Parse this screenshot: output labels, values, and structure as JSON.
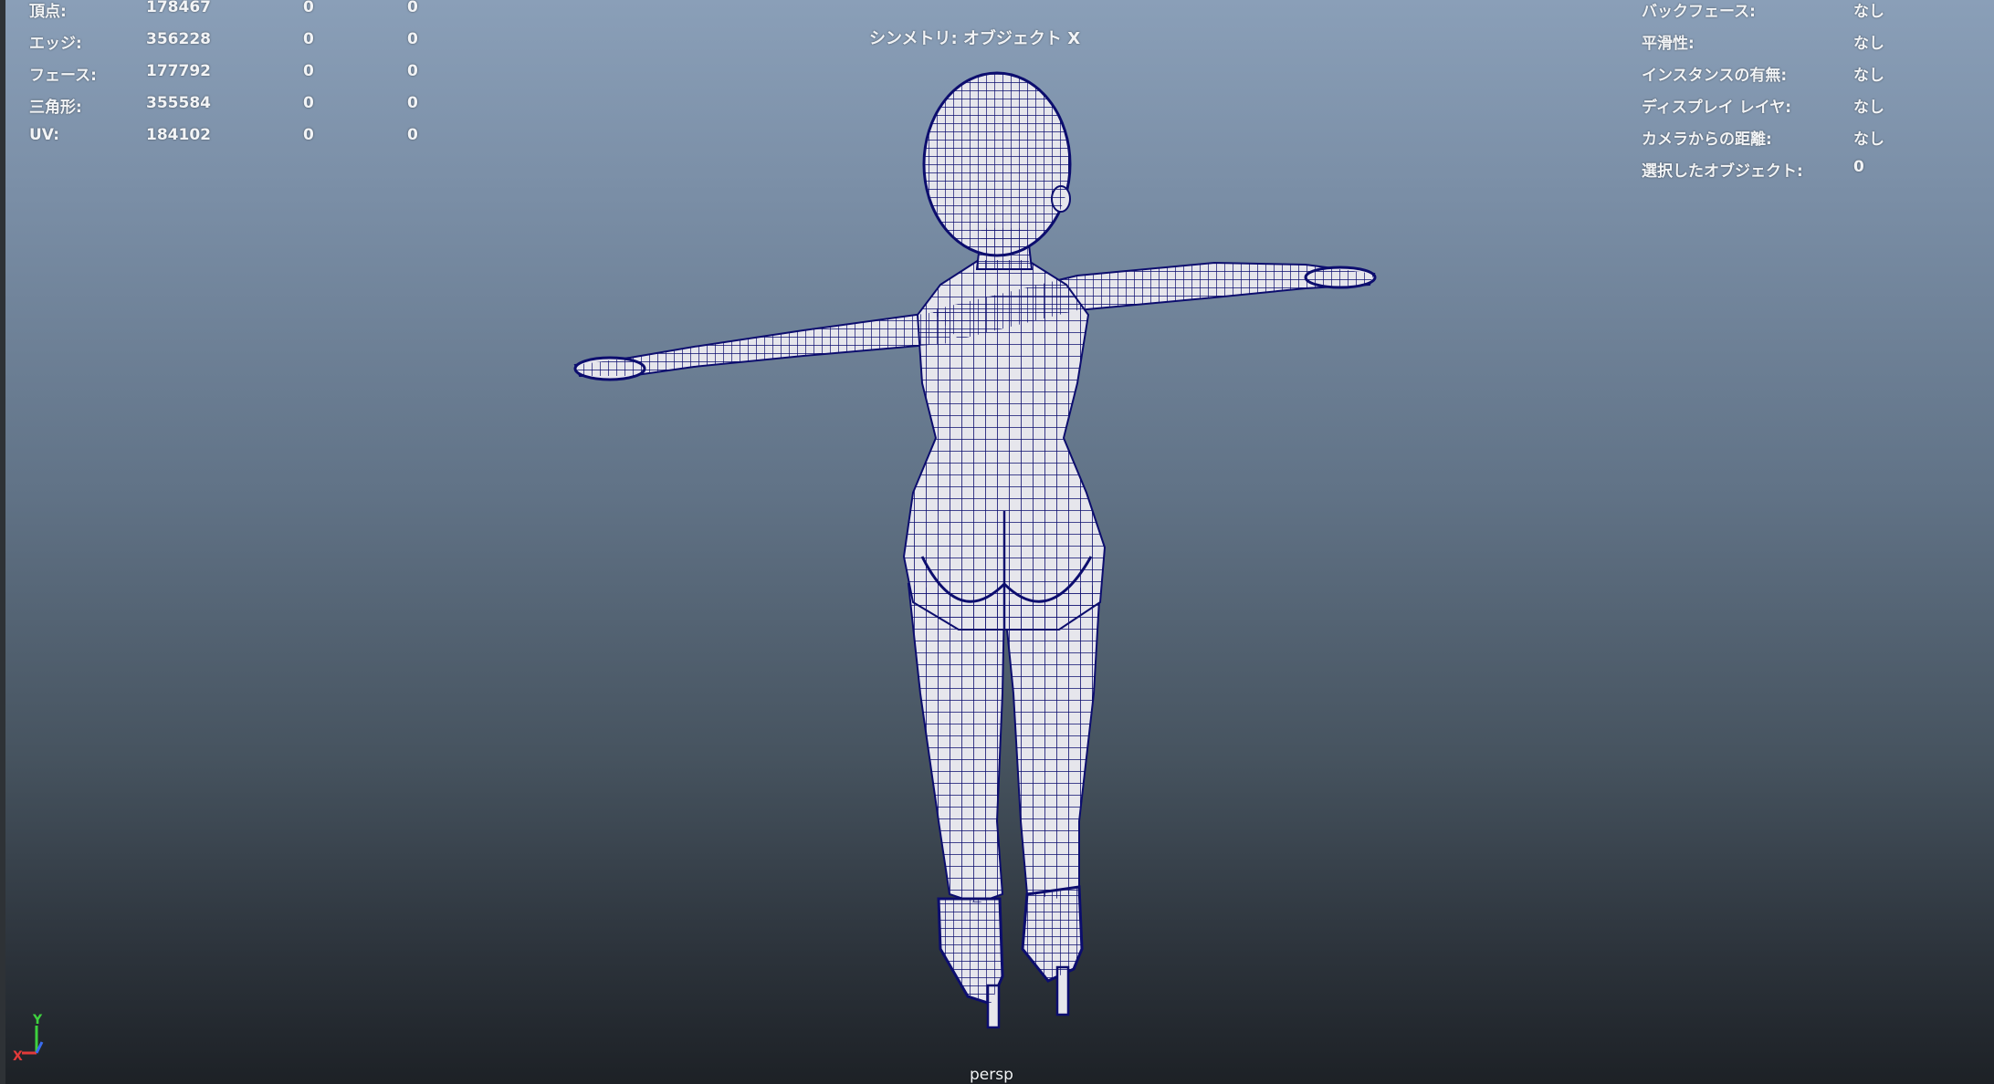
{
  "stats": [
    {
      "label": "頂点:",
      "count": "178467",
      "selected": "0",
      "uv": "0"
    },
    {
      "label": "エッジ:",
      "count": "356228",
      "selected": "0",
      "uv": "0"
    },
    {
      "label": "フェース:",
      "count": "177792",
      "selected": "0",
      "uv": "0"
    },
    {
      "label": "三角形:",
      "count": "355584",
      "selected": "0",
      "uv": "0"
    },
    {
      "label": "UV:",
      "count": "184102",
      "selected": "0",
      "uv": "0"
    }
  ],
  "info": [
    {
      "label": "バックフェース:",
      "value": "なし"
    },
    {
      "label": "平滑性:",
      "value": "なし"
    },
    {
      "label": "インスタンスの有無:",
      "value": "なし"
    },
    {
      "label": "ディスプレイ レイヤ:",
      "value": "なし"
    },
    {
      "label": "カメラからの距離:",
      "value": "なし"
    },
    {
      "label": "選択したオブジェクト:",
      "value": "0"
    }
  ],
  "symmetry": "シンメトリ: オブジェクト X",
  "camera": "persp",
  "axis": {
    "y": "Y",
    "x": "X",
    "colors": {
      "x": "#e23a3a",
      "y": "#3ed13e",
      "z": "#3a6cf0"
    }
  },
  "mesh": {
    "fill": "#e6e6ec",
    "wire": "#0c0d6e"
  }
}
